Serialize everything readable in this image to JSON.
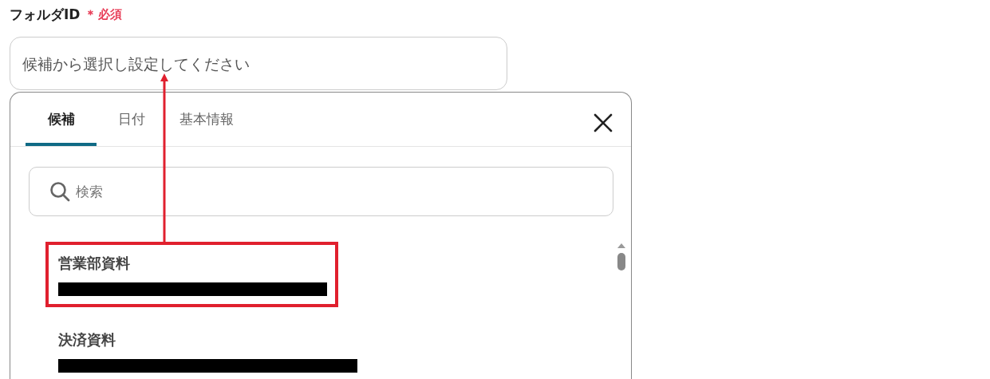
{
  "field": {
    "label": "フォルダID",
    "required_mark": "＊",
    "required_text": "必須",
    "placeholder": "候補から選択し設定してください"
  },
  "tabs": [
    {
      "label": "候補",
      "selected": true
    },
    {
      "label": "日付",
      "selected": false
    },
    {
      "label": "基本情報",
      "selected": false
    }
  ],
  "search": {
    "placeholder": "検索"
  },
  "items": [
    {
      "title": "営業部資料",
      "redacted": true,
      "highlighted": true
    },
    {
      "title": "決済資料",
      "redacted": true,
      "highlighted": false
    }
  ]
}
